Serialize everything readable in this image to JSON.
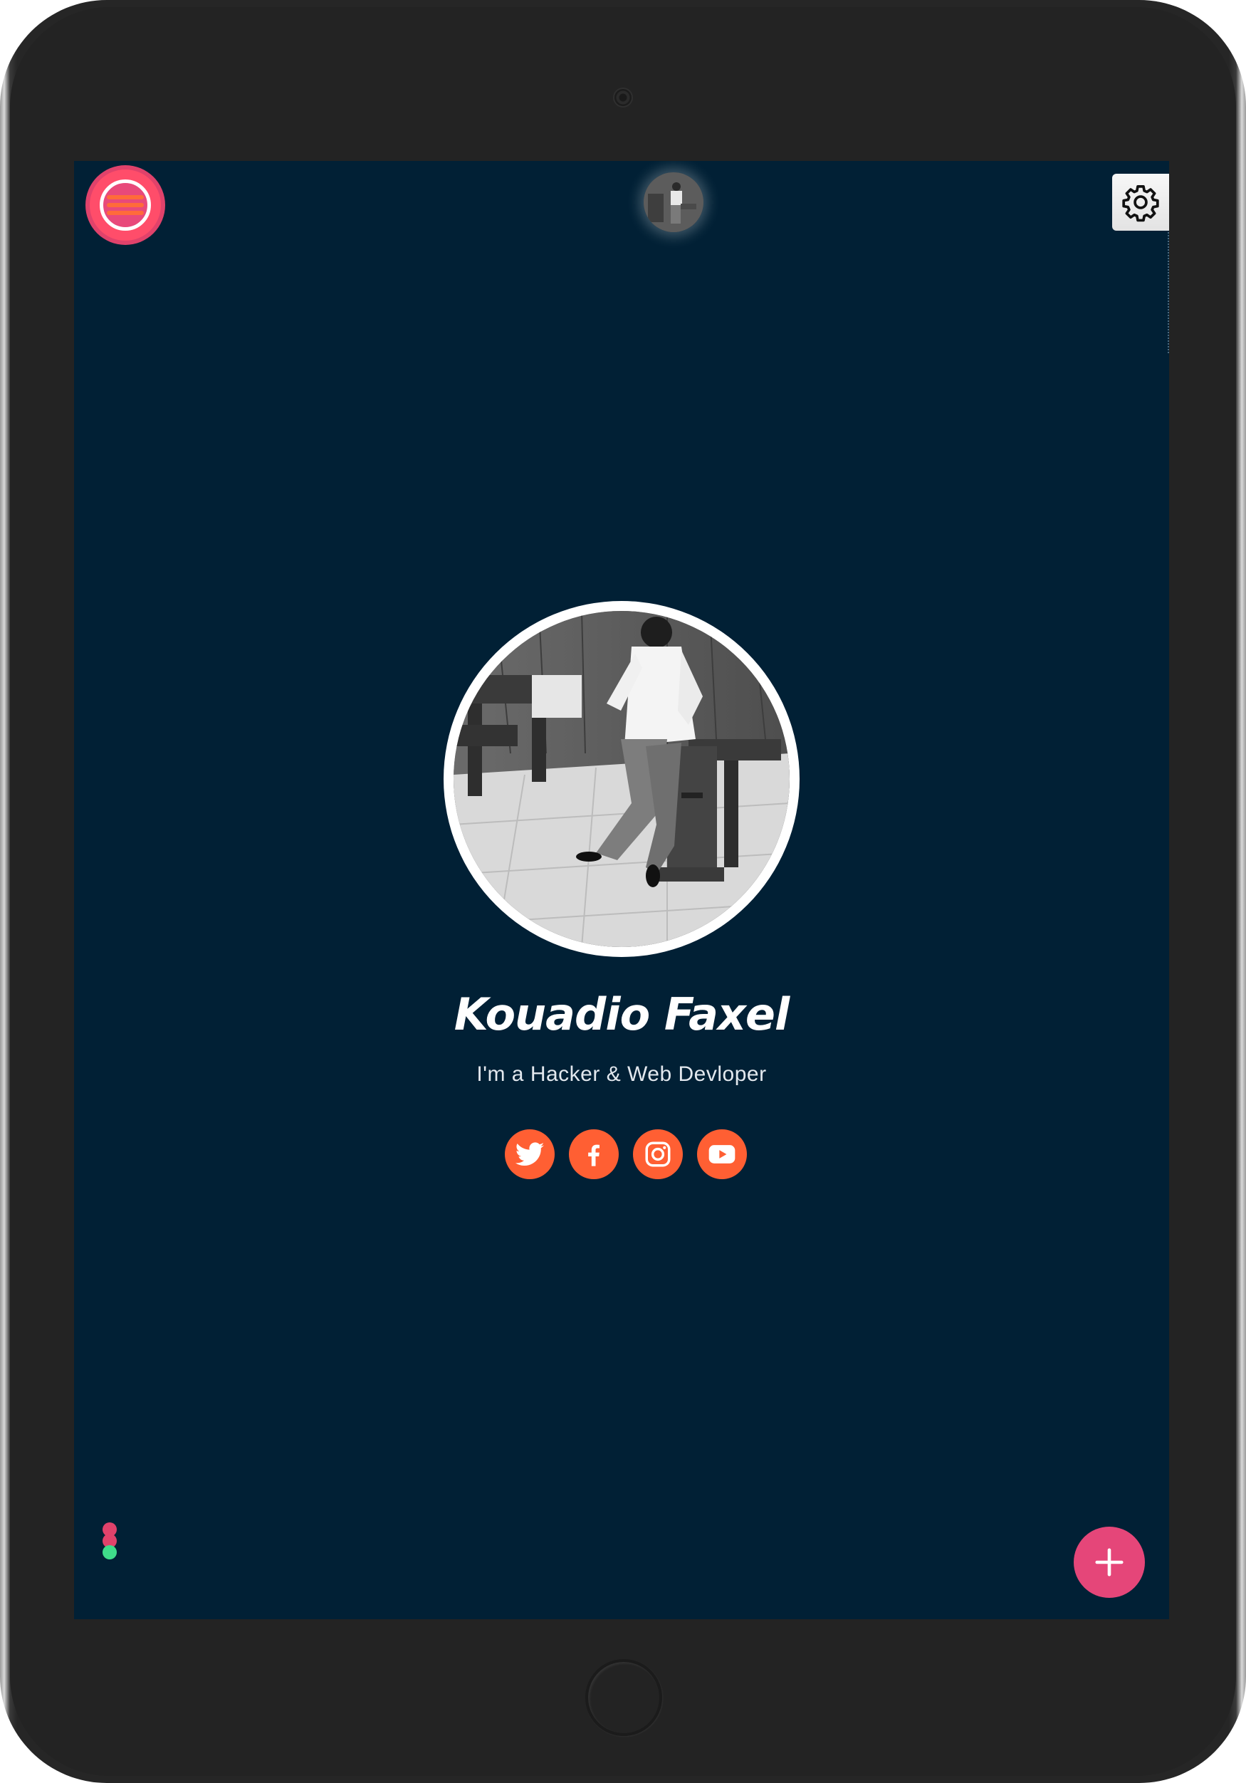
{
  "profile": {
    "name": "Kouadio Faxel",
    "tagline": "I'm a Hacker & Web Devloper"
  },
  "social": [
    {
      "network": "twitter",
      "icon": "twitter-icon"
    },
    {
      "network": "facebook",
      "icon": "facebook-icon"
    },
    {
      "network": "instagram",
      "icon": "instagram-icon"
    },
    {
      "network": "youtube",
      "icon": "youtube-icon"
    }
  ],
  "controls": {
    "menu_icon": "hamburger-menu-icon",
    "settings_icon": "gear-icon",
    "fab_icon": "plus-icon"
  },
  "status_dots": [
    "#e0426b",
    "#e0426b",
    "#3fdc8a"
  ],
  "colors": {
    "background": "#012035",
    "accent": "#e54679",
    "social": "#ff5f33",
    "device": "#232323"
  }
}
